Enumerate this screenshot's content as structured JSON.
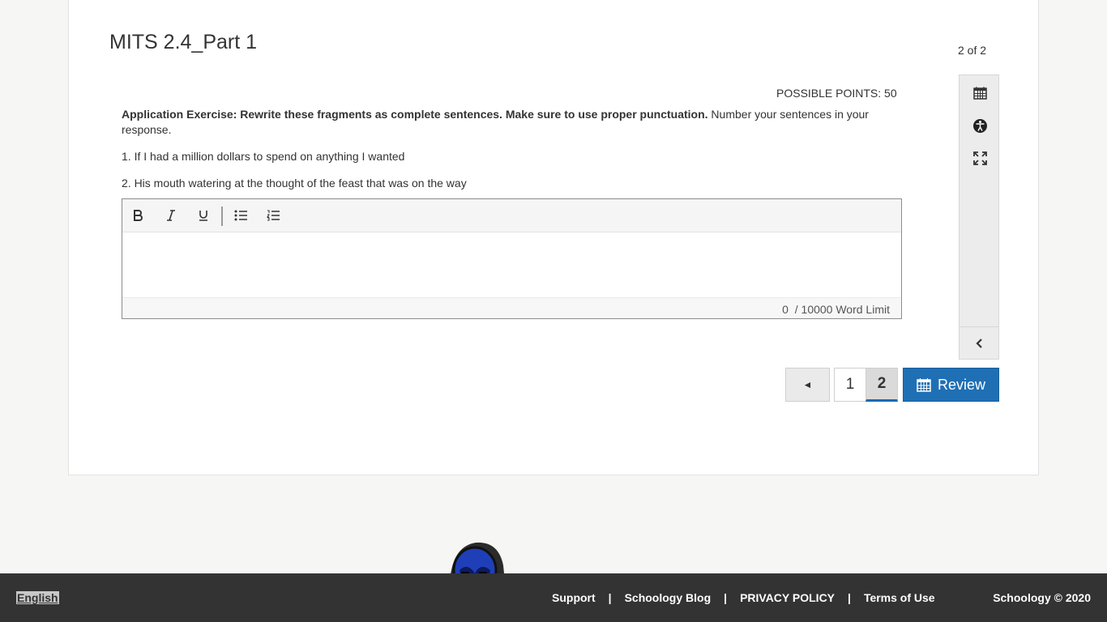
{
  "assessment": {
    "title": "MITS 2.4_Part 1",
    "counter": "2 of 2",
    "possible_points": "POSSIBLE POINTS: 50"
  },
  "question": {
    "bold_text": "Application Exercise: Rewrite these fragments as complete sentences. Make sure to use proper punctuation.",
    "normal_text": " Number your sentences in your response.",
    "items": [
      "1. If I had a million dollars to spend on anything I wanted",
      "2. His mouth watering at the thought of the feast that was on the way"
    ]
  },
  "editor": {
    "toolbar": [
      "bold-icon",
      "italic-icon",
      "underline-icon",
      "bulleted-list-icon",
      "numbered-list-icon"
    ],
    "word_count": "0",
    "word_limit": "/ 10000 Word Limit"
  },
  "sidebar": {
    "icons": [
      "calendar-icon",
      "accessibility-icon",
      "fullscreen-icon",
      "chevron-left-icon"
    ]
  },
  "pagination": {
    "prev": "◄",
    "pages": [
      "1",
      "2"
    ],
    "current": "2",
    "review": "Review"
  },
  "footer": {
    "language": "English",
    "links": [
      "Support",
      "Schoology Blog",
      "PRIVACY POLICY",
      "Terms of Use"
    ],
    "separator": "|",
    "copyright": "Schoology © 2020"
  },
  "colors": {
    "primary": "#1f6fb5",
    "footer_bg": "#333333",
    "page_bg": "#f6f6f5"
  }
}
